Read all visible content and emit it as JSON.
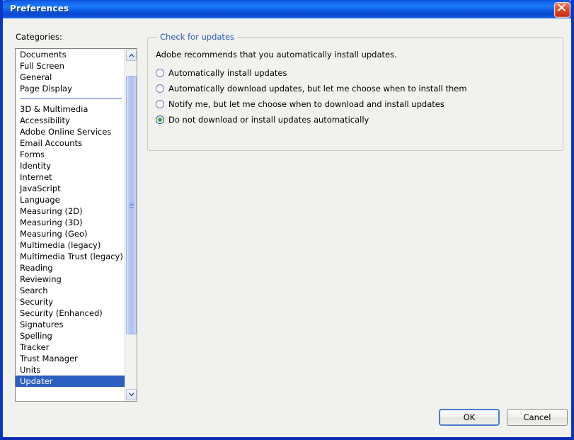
{
  "window": {
    "title": "Preferences",
    "close_icon": "close-icon"
  },
  "sidebar": {
    "label": "Categories:",
    "items": [
      {
        "label": "Documents",
        "selected": false
      },
      {
        "label": "Full Screen",
        "selected": false
      },
      {
        "label": "General",
        "selected": false
      },
      {
        "label": "Page Display",
        "selected": false
      },
      {
        "separator": true
      },
      {
        "label": "3D & Multimedia",
        "selected": false
      },
      {
        "label": "Accessibility",
        "selected": false
      },
      {
        "label": "Adobe Online Services",
        "selected": false
      },
      {
        "label": "Email Accounts",
        "selected": false
      },
      {
        "label": "Forms",
        "selected": false
      },
      {
        "label": "Identity",
        "selected": false
      },
      {
        "label": "Internet",
        "selected": false
      },
      {
        "label": "JavaScript",
        "selected": false
      },
      {
        "label": "Language",
        "selected": false
      },
      {
        "label": "Measuring (2D)",
        "selected": false
      },
      {
        "label": "Measuring (3D)",
        "selected": false
      },
      {
        "label": "Measuring (Geo)",
        "selected": false
      },
      {
        "label": "Multimedia (legacy)",
        "selected": false
      },
      {
        "label": "Multimedia Trust (legacy)",
        "selected": false
      },
      {
        "label": "Reading",
        "selected": false
      },
      {
        "label": "Reviewing",
        "selected": false
      },
      {
        "label": "Search",
        "selected": false
      },
      {
        "label": "Security",
        "selected": false
      },
      {
        "label": "Security (Enhanced)",
        "selected": false
      },
      {
        "label": "Signatures",
        "selected": false
      },
      {
        "label": "Spelling",
        "selected": false
      },
      {
        "label": "Tracker",
        "selected": false
      },
      {
        "label": "Trust Manager",
        "selected": false
      },
      {
        "label": "Units",
        "selected": false
      },
      {
        "label": "Updater",
        "selected": true
      }
    ],
    "scrollbar": {
      "up_icon": "chevron-up-icon",
      "down_icon": "chevron-down-icon"
    }
  },
  "main": {
    "group": {
      "legend": "Check for updates",
      "description": "Adobe recommends that you automatically install updates.",
      "options": [
        {
          "label": "Automatically install updates",
          "selected": false
        },
        {
          "label": "Automatically download updates, but let me choose when to install them",
          "selected": false
        },
        {
          "label": "Notify me, but let me choose when to download and install updates",
          "selected": false
        },
        {
          "label": "Do not download or install updates automatically",
          "selected": true
        }
      ]
    }
  },
  "footer": {
    "ok_label": "OK",
    "cancel_label": "Cancel"
  },
  "colors": {
    "titlebar_blue": "#0f5ce8",
    "selection_blue": "#2d5fc0",
    "legend_blue": "#2a5bbd",
    "radio_green": "#2aa832",
    "close_red": "#c62c11",
    "dialog_bg": "#f1f1ee"
  }
}
